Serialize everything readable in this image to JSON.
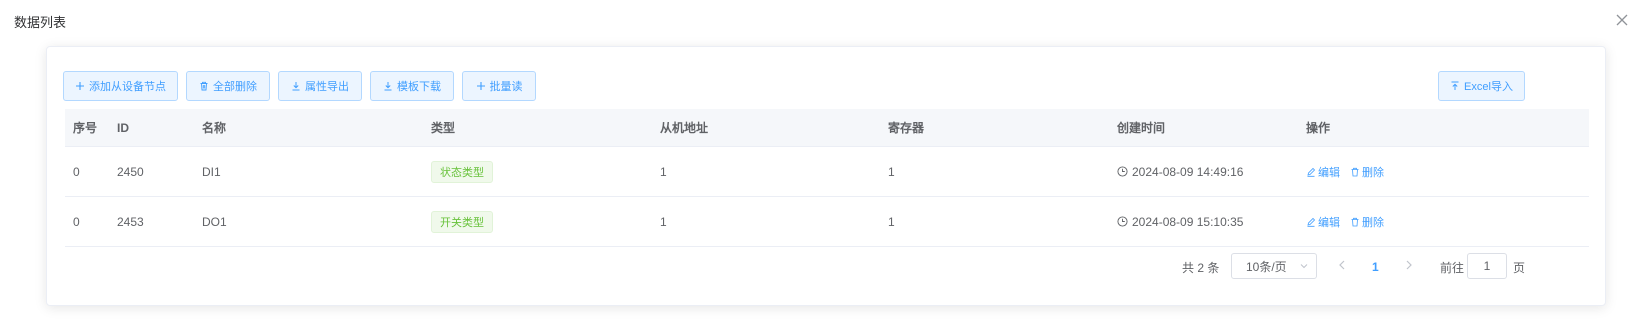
{
  "dialog": {
    "title": "数据列表"
  },
  "toolbar": {
    "add_label": "添加从设备节点",
    "delete_all_label": "全部删除",
    "export_label": "属性导出",
    "template_label": "模板下载",
    "batch_read_label": "批量读",
    "excel_import_label": "Excel导入"
  },
  "table": {
    "columns": [
      "序号",
      "ID",
      "名称",
      "类型",
      "从机地址",
      "寄存器",
      "创建时间",
      "操作"
    ],
    "rows": [
      {
        "index": "0",
        "id": "2450",
        "name": "DI1",
        "type": "状态类型",
        "slave_address": "1",
        "register": "1",
        "created": "2024-08-09 14:49:16"
      },
      {
        "index": "0",
        "id": "2453",
        "name": "DO1",
        "type": "开关类型",
        "slave_address": "1",
        "register": "1",
        "created": "2024-08-09 15:10:35"
      }
    ],
    "actions": {
      "edit": "编辑",
      "delete": "删除"
    }
  },
  "pagination": {
    "total": "共 2 条",
    "page_size": "10条/页",
    "current_page": "1",
    "goto_prefix": "前往",
    "goto_value": "1",
    "goto_suffix": "页"
  },
  "colors": {
    "primary": "#409eff",
    "success_tag": "#67c23a"
  }
}
